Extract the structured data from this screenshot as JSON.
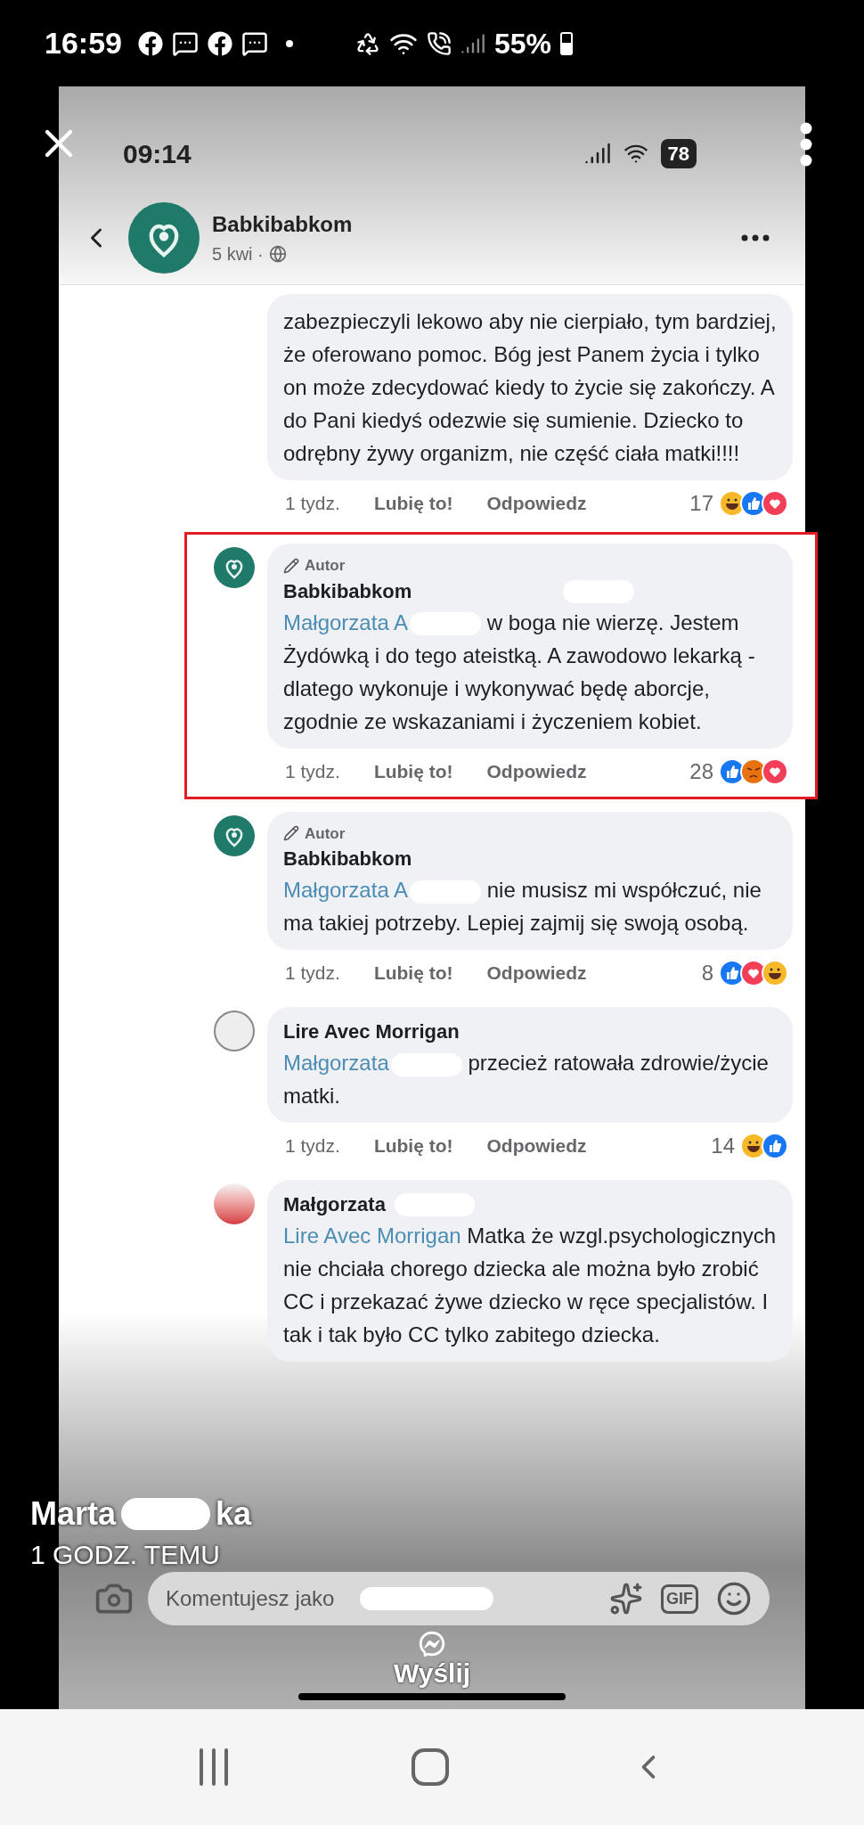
{
  "device_status_bar": {
    "time": "16:59",
    "battery": "55%"
  },
  "story": {
    "author_first": "Marta",
    "author_last_end": "ka",
    "time": "1 GODZ. TEMU",
    "send_label": "Wyślij"
  },
  "post": {
    "status_time": "09:14",
    "battery": "78",
    "page_name": "Babkibabkom",
    "date": "5 kwi ·"
  },
  "comments": [
    {
      "text": "zabezpieczyli lekowo aby nie cierpiało, tym bardziej, że oferowano pomoc. Bóg jest Panem życia i tylko on może zdecydować kiedy to życie się zakończy. A do Pani kiedyś odezwie się sumienie. Dziecko to odrębny żywy organizm, nie część ciała matki!!!!",
      "time": "1 tydz.",
      "like": "Lubię to!",
      "reply": "Odpowiedz",
      "count": "17",
      "reactions": [
        {
          "kind": "haha"
        },
        {
          "kind": "like"
        },
        {
          "kind": "love"
        }
      ],
      "highlighted": false
    },
    {
      "avatar": {
        "kind": "logo"
      },
      "badge": "Autor",
      "name": "Babkibabkom",
      "name_redacted": true,
      "mention": "Małgorzata A",
      "mention_redacted": true,
      "text": "w boga nie wierzę. Jestem Żydówką i do tego ateistką. A zawodowo lekarką - dlatego wykonuje i wykonywać będę aborcje, zgodnie ze wskazaniami i życzeniem kobiet.",
      "time": "1 tydz.",
      "like": "Lubię to!",
      "reply": "Odpowiedz",
      "count": "28",
      "reactions": [
        {
          "kind": "like"
        },
        {
          "kind": "angry"
        },
        {
          "kind": "love"
        }
      ],
      "highlighted": true
    },
    {
      "avatar": {
        "kind": "logo"
      },
      "badge": "Autor",
      "name": "Babkibabkom",
      "name_redacted": false,
      "mention": "Małgorzata A",
      "mention_redacted": true,
      "text": "nie musisz mi współczuć, nie ma takiej potrzeby. Lepiej zajmij się swoją osobą.",
      "time": "1 tydz.",
      "like": "Lubię to!",
      "reply": "Odpowiedz",
      "count": "8",
      "reactions": [
        {
          "kind": "like"
        },
        {
          "kind": "love"
        },
        {
          "kind": "haha"
        }
      ],
      "highlighted": false
    },
    {
      "avatar": {
        "kind": "drawing"
      },
      "name": "Lire Avec Morrigan",
      "name_redacted": false,
      "mention": "Małgorzata",
      "mention_redacted": true,
      "text": "przecież ratowała zdrowie/życie matki.",
      "time": "1 tydz.",
      "like": "Lubię to!",
      "reply": "Odpowiedz",
      "count": "14",
      "reactions": [
        {
          "kind": "haha"
        },
        {
          "kind": "like"
        }
      ],
      "highlighted": false
    },
    {
      "avatar": {
        "kind": "photo"
      },
      "name": "Małgorzata",
      "name_redacted": true,
      "mention": "Lire Avec Morrigan",
      "mention_redacted": false,
      "text": "Matka że wzgl.psychologicznych nie chciała chorego dziecka ale można było zrobić CC i przekazać żywe dziecko w ręce specjalistów. I tak i tak było CC tylko zabitego dziecka.",
      "highlighted": false
    }
  ],
  "composer": {
    "placeholder": "Komentujesz jako",
    "gif_label": "GIF"
  }
}
